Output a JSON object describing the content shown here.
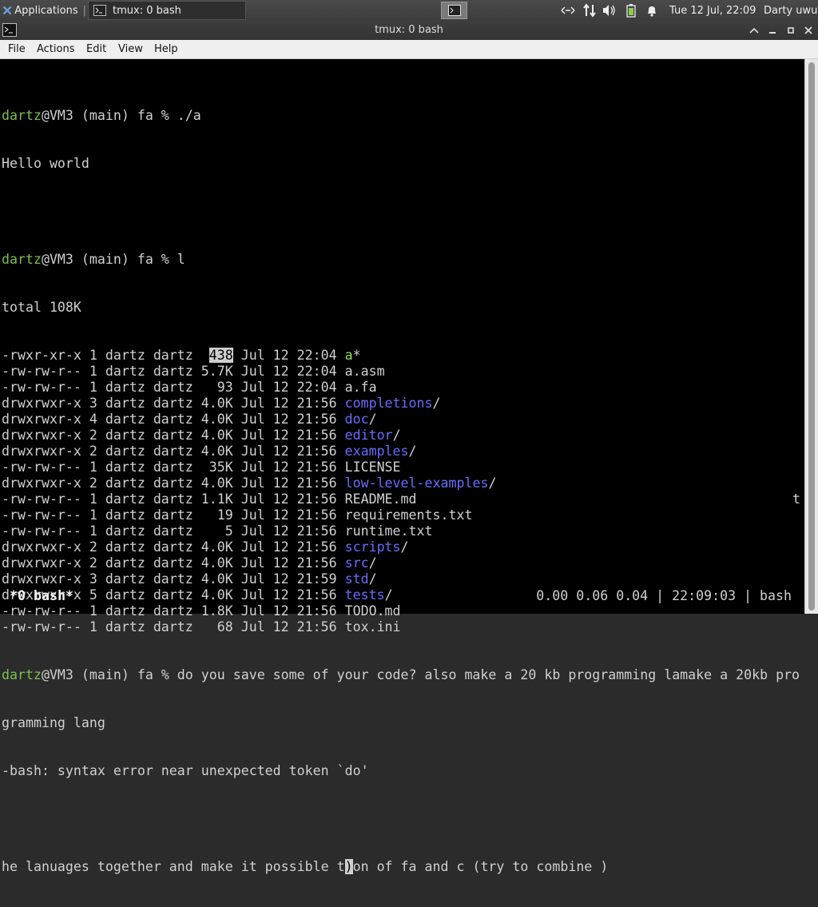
{
  "panel": {
    "app_menu": "Applications",
    "task": "tmux: 0 bash",
    "clock": "Tue 12 Jul, 22:09",
    "user": "Darty uwu"
  },
  "window": {
    "title": "tmux: 0 bash"
  },
  "menubar": [
    "File",
    "Actions",
    "Edit",
    "View",
    "Help"
  ],
  "terminal": {
    "prompt_user": "dartz",
    "prompt_rest": "@VM3 (main) fa % ",
    "cmd1": "./a",
    "out1": "Hello world",
    "cmd2": "l",
    "total": "total 108K",
    "listing": [
      {
        "meta": "-rwxr-xr-x 1 dartz dartz  ",
        "size": "438",
        "date": " Jul 12 22:04 ",
        "name": "a",
        "suffix": "*",
        "kind": "exec"
      },
      {
        "meta": "-rw-rw-r-- 1 dartz dartz ",
        "size": "5.7K",
        "date": " Jul 12 22:04 ",
        "name": "a.asm",
        "suffix": "",
        "kind": "file"
      },
      {
        "meta": "-rw-rw-r-- 1 dartz dartz   ",
        "size": "93",
        "date": " Jul 12 22:04 ",
        "name": "a.fa",
        "suffix": "",
        "kind": "file"
      },
      {
        "meta": "drwxrwxr-x 3 dartz dartz ",
        "size": "4.0K",
        "date": " Jul 12 21:56 ",
        "name": "completions",
        "suffix": "/",
        "kind": "dir"
      },
      {
        "meta": "drwxrwxr-x 4 dartz dartz ",
        "size": "4.0K",
        "date": " Jul 12 21:56 ",
        "name": "doc",
        "suffix": "/",
        "kind": "dir"
      },
      {
        "meta": "drwxrwxr-x 2 dartz dartz ",
        "size": "4.0K",
        "date": " Jul 12 21:56 ",
        "name": "editor",
        "suffix": "/",
        "kind": "dir"
      },
      {
        "meta": "drwxrwxr-x 2 dartz dartz ",
        "size": "4.0K",
        "date": " Jul 12 21:56 ",
        "name": "examples",
        "suffix": "/",
        "kind": "dir"
      },
      {
        "meta": "-rw-rw-r-- 1 dartz dartz  ",
        "size": "35K",
        "date": " Jul 12 21:56 ",
        "name": "LICENSE",
        "suffix": "",
        "kind": "file"
      },
      {
        "meta": "drwxrwxr-x 2 dartz dartz ",
        "size": "4.0K",
        "date": " Jul 12 21:56 ",
        "name": "low-level-examples",
        "suffix": "/",
        "kind": "dir"
      },
      {
        "meta": "-rw-rw-r-- 1 dartz dartz ",
        "size": "1.1K",
        "date": " Jul 12 21:56 ",
        "name": "README.md",
        "suffix": "",
        "kind": "file"
      },
      {
        "meta": "-rw-rw-r-- 1 dartz dartz   ",
        "size": "19",
        "date": " Jul 12 21:56 ",
        "name": "requirements.txt",
        "suffix": "",
        "kind": "file"
      },
      {
        "meta": "-rw-rw-r-- 1 dartz dartz    ",
        "size": "5",
        "date": " Jul 12 21:56 ",
        "name": "runtime.txt",
        "suffix": "",
        "kind": "file"
      },
      {
        "meta": "drwxrwxr-x 2 dartz dartz ",
        "size": "4.0K",
        "date": " Jul 12 21:56 ",
        "name": "scripts",
        "suffix": "/",
        "kind": "dir"
      },
      {
        "meta": "drwxrwxr-x 2 dartz dartz ",
        "size": "4.0K",
        "date": " Jul 12 21:56 ",
        "name": "src",
        "suffix": "/",
        "kind": "dir"
      },
      {
        "meta": "drwxrwxr-x 3 dartz dartz ",
        "size": "4.0K",
        "date": " Jul 12 21:59 ",
        "name": "std",
        "suffix": "/",
        "kind": "dir"
      },
      {
        "meta": "drwxrwxr-x 5 dartz dartz ",
        "size": "4.0K",
        "date": " Jul 12 21:56 ",
        "name": "tests",
        "suffix": "/",
        "kind": "dir"
      },
      {
        "meta": "-rw-rw-r-- 1 dartz dartz ",
        "size": "1.8K",
        "date": " Jul 12 21:56 ",
        "name": "TODO.md",
        "suffix": "",
        "kind": "file"
      },
      {
        "meta": "-rw-rw-r-- 1 dartz dartz   ",
        "size": "68",
        "date": " Jul 12 21:56 ",
        "name": "tox.ini",
        "suffix": "",
        "kind": "file"
      }
    ],
    "cmd3": "do you save some of your code? also make a 20 kb programming lamake a 20kb pro",
    "cmd3_wrap": "gramming lang",
    "error": "-bash: syntax error near unexpected token `do'",
    "stray_char": "t",
    "input_before": "he lanuages together and make it possible t",
    "input_cursor": ")",
    "input_after": "on of fa and c (try to combine )"
  },
  "status": {
    "left": "*0 bash*",
    "right": "0.00 0.06 0.04 | 22:09:03 | bash"
  },
  "colors": {
    "prompt_user": "#7cbf52",
    "directory": "#6b6bff",
    "executable": "#8be05a"
  }
}
